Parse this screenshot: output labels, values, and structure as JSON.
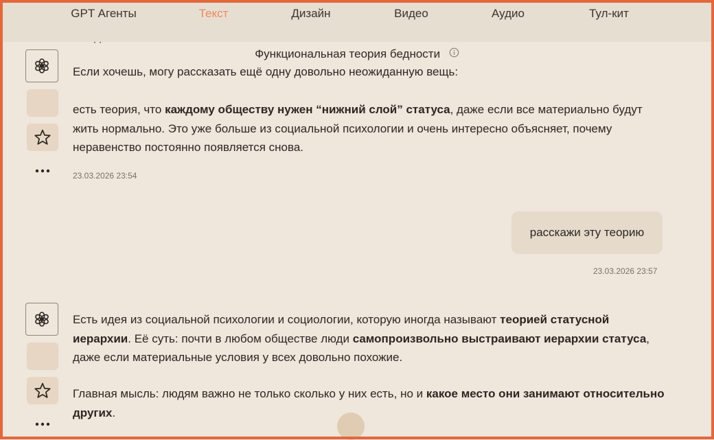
{
  "nav": {
    "items": [
      {
        "label": "GPT Агенты"
      },
      {
        "label": "Текст",
        "active": true
      },
      {
        "label": "Дизайн"
      },
      {
        "label": "Видео"
      },
      {
        "label": "Аудио"
      },
      {
        "label": "Тул-кит"
      }
    ],
    "active_color": "#ee8a5e"
  },
  "chat": {
    "title": "Функциональная теория бедности",
    "faded_text": "…о д…",
    "messages": [
      {
        "role": "assistant",
        "paragraphs": [
          [
            {
              "t": "Если хочешь, могу рассказать ещё одну довольно неожиданную вещь:"
            }
          ],
          [
            {
              "t": "есть теория, что "
            },
            {
              "t": "каждому обществу нужен “нижний слой” статуса",
              "b": true
            },
            {
              "t": ", даже если все материально будут жить нормально. Это уже больше из социальной психологии и очень интересно объясняет, почему неравенство постоянно появляется снова."
            }
          ]
        ],
        "timestamp": "23.03.2026 23:54"
      },
      {
        "role": "user",
        "text": "расскажи эту теорию",
        "timestamp": "23.03.2026 23:57"
      },
      {
        "role": "assistant",
        "paragraphs": [
          [
            {
              "t": "Есть идея из социальной психологии и социологии, которую иногда называют "
            },
            {
              "t": "теорией статусной иерархии",
              "b": true
            },
            {
              "t": ". Её суть: почти в любом обществе люди "
            },
            {
              "t": "самопроизвольно выстраивают иерархии статуса",
              "b": true
            },
            {
              "t": ", даже если материальные условия у всех довольно похожие."
            }
          ],
          [
            {
              "t": "Главная мысль: людям важно не только сколько у них есть, но и "
            },
            {
              "t": "какое место они занимают относительно других",
              "b": true
            },
            {
              "t": "."
            }
          ]
        ]
      }
    ]
  },
  "colors": {
    "background": "#efe6dc",
    "frame": "#e2683c",
    "bubble": "#e6dacb"
  }
}
